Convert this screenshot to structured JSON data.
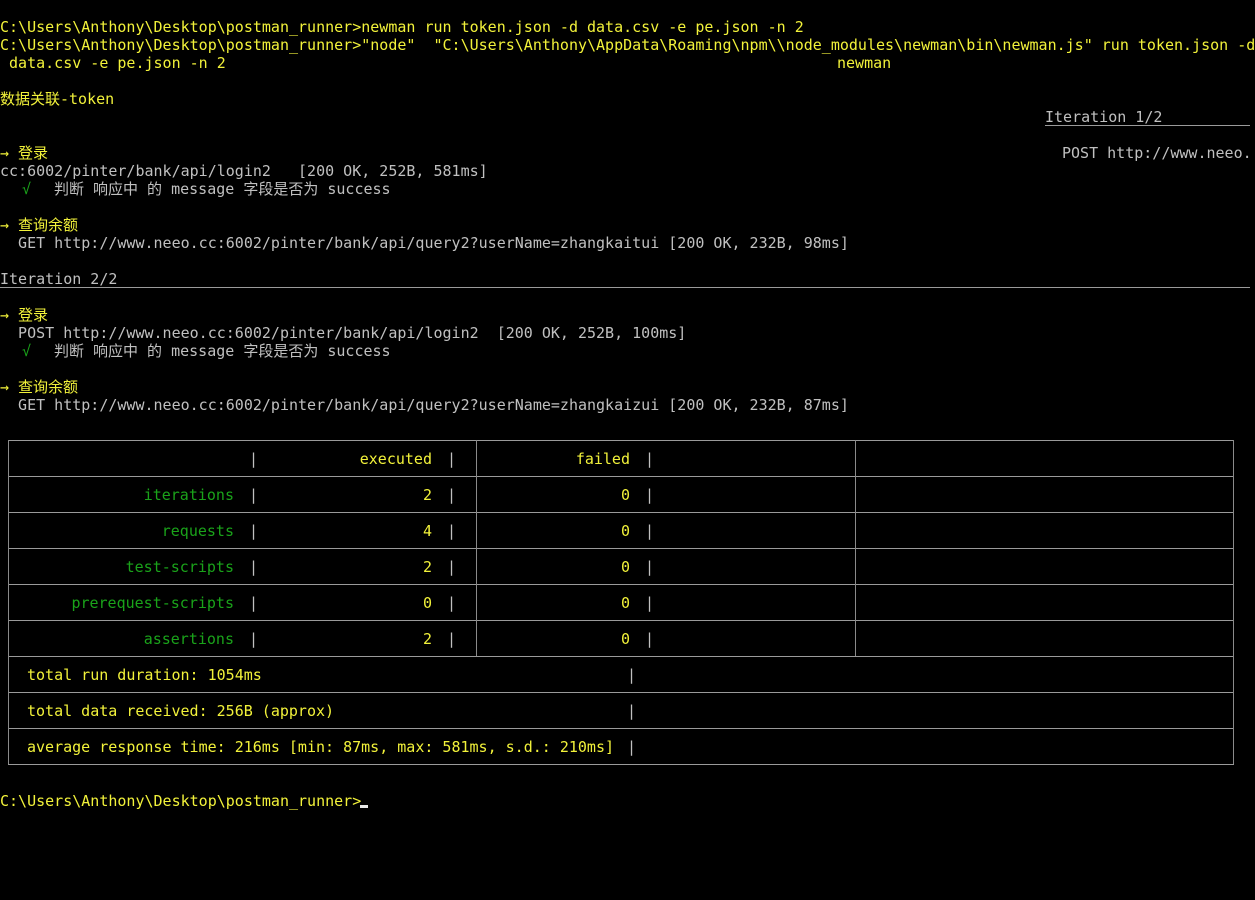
{
  "terminal": {
    "lines": {
      "cmd1": "C:\\Users\\Anthony\\Desktop\\postman_runner>newman run token.json -d data.csv -e pe.json -n 2",
      "cmd2": "C:\\Users\\Anthony\\Desktop\\postman_runner>\"node\"  \"C:\\Users\\Anthony\\AppData\\Roaming\\npm\\\\node_modules\\newman\\bin\\newman.js\" run token.json -d",
      "cmd3": " data.csv -e pe.json -n 2",
      "cmd3_tail": "newman",
      "collection": "数据关联-token",
      "iter1": "Iteration 1/2",
      "req1_name": "→ 登录",
      "req1_method_url": "POST http://www.neeo.",
      "req1_url_cont": "cc:6002/pinter/bank/api/login2   [200 OK, 252B, 581ms]",
      "req1_check_mark": "√",
      "req1_check_text": "判断 响应中 的 message 字段是否为 success",
      "req2_name": "→ 查询余额",
      "req2_line": "  GET http://www.neeo.cc:6002/pinter/bank/api/query2?userName=zhangkaitui [200 OK, 232B, 98ms]",
      "iter2": "Iteration 2/2",
      "req3_name": "→ 登录",
      "req3_line": "  POST http://www.neeo.cc:6002/pinter/bank/api/login2  [200 OK, 252B, 100ms]",
      "req3_check_mark": "√",
      "req3_check_text": "判断 响应中 的 message 字段是否为 success",
      "req4_name": "→ 查询余额",
      "req4_line": "  GET http://www.neeo.cc:6002/pinter/bank/api/query2?userName=zhangkaizui [200 OK, 232B, 87ms]",
      "prompt": "C:\\Users\\Anthony\\Desktop\\postman_runner>"
    },
    "summary": {
      "headers": [
        "executed",
        "failed"
      ],
      "rows": [
        {
          "label": "iterations",
          "executed": "2",
          "failed": "0"
        },
        {
          "label": "requests",
          "executed": "4",
          "failed": "0"
        },
        {
          "label": "test-scripts",
          "executed": "2",
          "failed": "0"
        },
        {
          "label": "prerequest-scripts",
          "executed": "0",
          "failed": "0"
        },
        {
          "label": "assertions",
          "executed": "2",
          "failed": "0"
        }
      ],
      "duration": "total run duration: 1054ms",
      "data_received": "total data received: 256B (approx)",
      "avg_response": "average response time: 216ms [min: 87ms, max: 581ms, s.d.: 210ms]"
    },
    "colors": {
      "yellow": "#f2f23a",
      "green": "#1aa31a",
      "gray": "#c0c0c0",
      "white": "#e8e8e8",
      "background": "#000000"
    }
  }
}
